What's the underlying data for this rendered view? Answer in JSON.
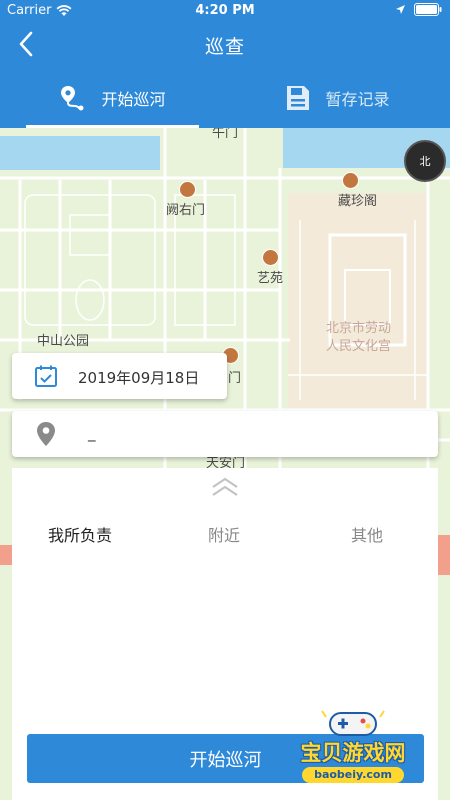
{
  "status": {
    "carrier": "Carrier",
    "time": "4:20 PM"
  },
  "nav": {
    "title": "巡查"
  },
  "tabs": [
    {
      "label": "开始巡河",
      "icon": "route-pin-icon",
      "active": true
    },
    {
      "label": "暂存记录",
      "icon": "save-icon",
      "active": false
    }
  ],
  "map": {
    "labels": [
      "午门",
      "阙右门",
      "藏珍阁",
      "艺苑",
      "中山公园",
      "北京市劳动",
      "人民文化宫",
      "门",
      "天安门"
    ],
    "compass": "北"
  },
  "date": {
    "value": "2019年09月18日"
  },
  "location": {
    "value": "_"
  },
  "segments": [
    "我所负责",
    "附近",
    "其他"
  ],
  "start_button": {
    "label": "开始巡河"
  },
  "watermark": {
    "title": "宝贝游戏网",
    "url": "baobeiy.com"
  },
  "colors": {
    "primary": "#2e89d8",
    "map_green": "#e9f3d9",
    "map_beige": "#f3ead9"
  }
}
